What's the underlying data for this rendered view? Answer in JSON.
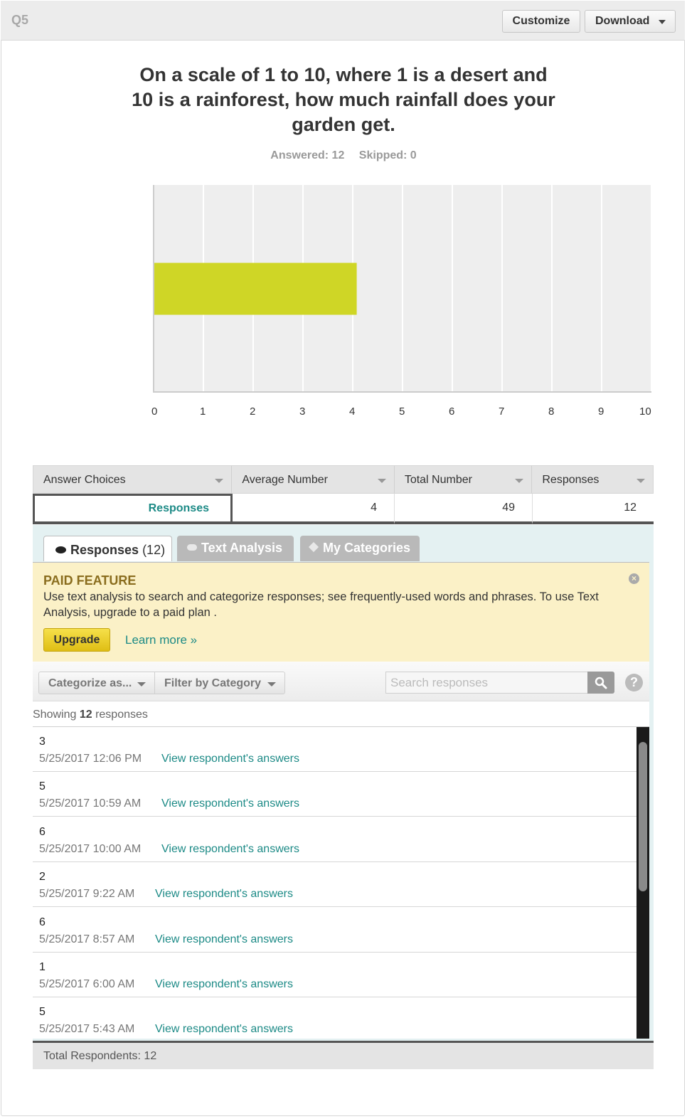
{
  "header": {
    "question_number": "Q5",
    "customize_label": "Customize",
    "download_label": "Download"
  },
  "question": {
    "title": "On a scale of 1 to 10, where 1 is a desert and 10 is a rainforest, how much rainfall does your garden get.",
    "answered": "Answered: 12",
    "skipped": "Skipped: 0"
  },
  "chart_data": {
    "type": "bar",
    "orientation": "horizontal",
    "categories": [
      "Responses"
    ],
    "values": [
      4.08
    ],
    "xlim": [
      0,
      10
    ],
    "xticks": [
      "0",
      "1",
      "2",
      "3",
      "4",
      "5",
      "6",
      "7",
      "8",
      "9",
      "10"
    ],
    "bar_color": "#cfd626",
    "grid": true
  },
  "summary": {
    "headers": [
      "Answer Choices",
      "Average Number",
      "Total Number",
      "Responses"
    ],
    "row": {
      "choice": "Responses",
      "average": "4",
      "total": "49",
      "responses": "12"
    }
  },
  "tabs": {
    "responses_label": "Responses",
    "responses_count": "(12)",
    "text_analysis_label": "Text Analysis",
    "my_categories_label": "My Categories"
  },
  "paid_feature": {
    "title": "PAID FEATURE",
    "text": "Use text analysis to search and categorize responses; see frequently-used words and phrases. To use Text Analysis, upgrade to a paid plan .",
    "upgrade_label": "Upgrade",
    "learn_more_label": "Learn more »"
  },
  "filters": {
    "categorize_label": "Categorize as...",
    "filter_label": "Filter by Category",
    "search_placeholder": "Search responses",
    "help": "?"
  },
  "showing": {
    "prefix": "Showing",
    "count": "12",
    "suffix": "responses"
  },
  "responses": [
    {
      "value": "3",
      "date": "5/25/2017 12:06 PM",
      "link": "View respondent's answers"
    },
    {
      "value": "5",
      "date": "5/25/2017 10:59 AM",
      "link": "View respondent's answers"
    },
    {
      "value": "6",
      "date": "5/25/2017 10:00 AM",
      "link": "View respondent's answers"
    },
    {
      "value": "2",
      "date": "5/25/2017 9:22 AM",
      "link": "View respondent's answers"
    },
    {
      "value": "6",
      "date": "5/25/2017 8:57 AM",
      "link": "View respondent's answers"
    },
    {
      "value": "1",
      "date": "5/25/2017 6:00 AM",
      "link": "View respondent's answers"
    },
    {
      "value": "5",
      "date": "5/25/2017 5:43 AM",
      "link": "View respondent's answers"
    }
  ],
  "footer": {
    "total_respondents": "Total Respondents: 12"
  },
  "colors": {
    "accent": "#1c8a86",
    "bar": "#cfd626",
    "paid_bg": "#fbf1c7"
  }
}
